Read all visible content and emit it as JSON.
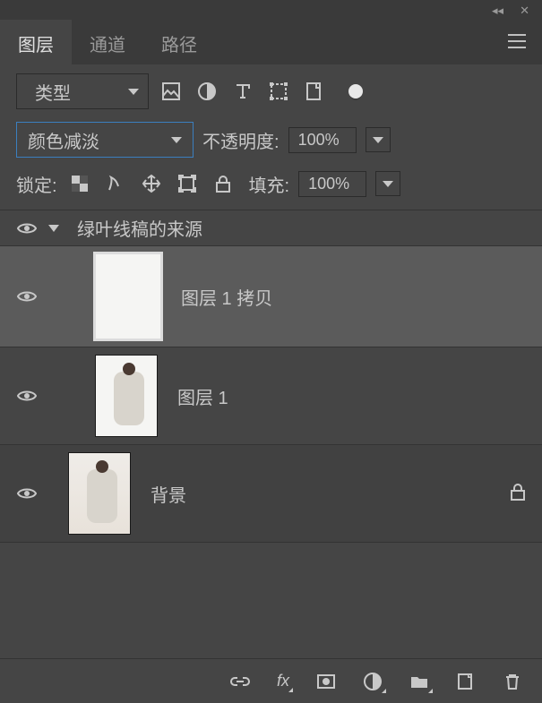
{
  "titlebar": {
    "collapse_glyph": "◂◂",
    "close_glyph": "✕"
  },
  "tabs": [
    {
      "label": "图层",
      "active": true
    },
    {
      "label": "通道",
      "active": false
    },
    {
      "label": "路径",
      "active": false
    }
  ],
  "filter": {
    "icon": "search-icon",
    "label": "类型",
    "type_icons": [
      "pixel-filter-icon",
      "adjustment-filter-icon",
      "type-filter-icon",
      "shape-filter-icon",
      "smart-filter-icon",
      "toggle-filter-icon"
    ]
  },
  "blend": {
    "mode": "颜色减淡",
    "opacity_label": "不透明度:",
    "opacity_value": "100%"
  },
  "lock": {
    "label": "锁定:",
    "fill_label": "填充:",
    "fill_value": "100%",
    "icons": [
      "lock-transparent-icon",
      "lock-image-icon",
      "lock-position-icon",
      "lock-artboard-icon",
      "lock-all-icon"
    ]
  },
  "layers": {
    "group_name": "绿叶线稿的来源",
    "items": [
      {
        "name": "图层 1 拷贝",
        "selected": true,
        "thumb": "white"
      },
      {
        "name": "图层 1",
        "selected": false,
        "thumb": "photo"
      },
      {
        "name": "背景",
        "selected": false,
        "thumb": "photo-bg",
        "locked": true
      }
    ]
  },
  "bottom": {
    "icons": [
      "link-icon",
      "fx-icon",
      "mask-icon",
      "adjustment-icon",
      "group-icon",
      "new-layer-icon",
      "trash-icon"
    ]
  }
}
